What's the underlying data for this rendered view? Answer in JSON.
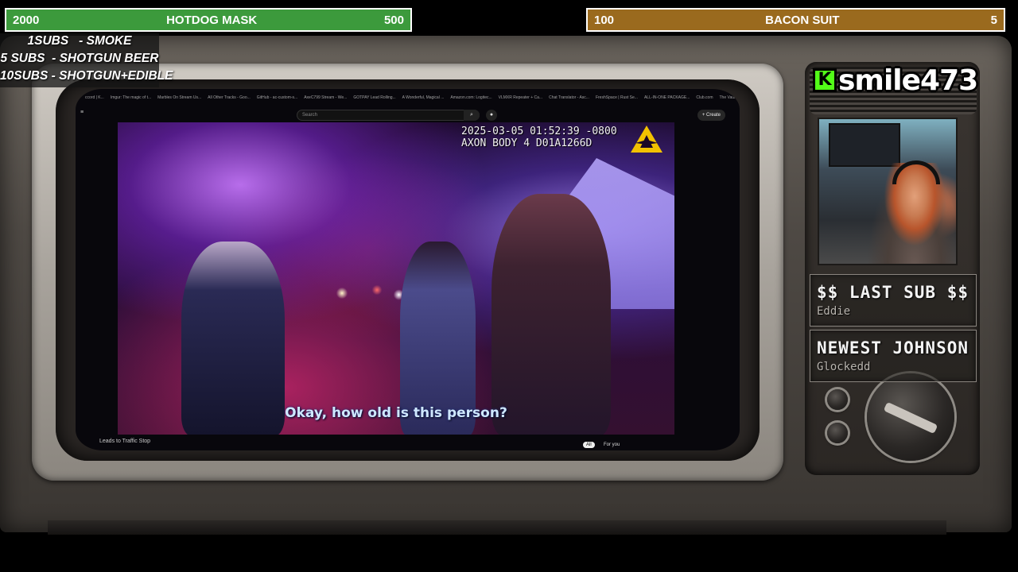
{
  "goals": {
    "left": {
      "start": "2000",
      "title": "HOTDOG MASK",
      "end": "500",
      "color": "#3c9a3c"
    },
    "right": {
      "start": "100",
      "title": "BACON SUIT",
      "end": "5",
      "color": "#9a6a1e"
    }
  },
  "sub_menu": {
    "lines": [
      "1SUBS   - SMOKE",
      "5 SUBS  - SHOTGUN BEER",
      "10SUBS - SHOTGUN+EDIBLE"
    ]
  },
  "browser": {
    "bookmarks": [
      "ccord | K...",
      "Imgur: The magic of t...",
      "Marbles On Stream Us...",
      "All Other Tracks - Goo...",
      "GitHub - ac-custom-s...",
      "AxeC799 Stream - We...",
      "GOTPAY Lead Rolling...",
      "A Wonderful, Magical ...",
      "Amazon.com: Logitec...",
      "VLMXR Repeater + Ca...",
      "Chat Translator - Asc...",
      "FreshSpace | Rust Se...",
      "ALL-IN-ONE PACKAGE...",
      "Club.com",
      "The Vault Aggressive ..."
    ],
    "search_placeholder": "Search",
    "menu_icon": "≡",
    "search_icon": "⌕",
    "mic_icon": "🎤",
    "create_label": "+ Create",
    "video_title": "Leads to Traffic Stop",
    "chip_all": "All",
    "chip_for_you": "For you"
  },
  "video": {
    "timestamp_line1": "2025-03-05 01:52:39 -0800",
    "timestamp_line2": "AXON BODY 4 D01A1266D",
    "subtitle": "Okay, how old is this person?"
  },
  "streamer": {
    "platform_icon": "K",
    "platform_color": "#53fc18",
    "name": "smile473"
  },
  "last_sub": {
    "title": "$$ LAST SUB $$",
    "value": "Eddie"
  },
  "newest": {
    "title": "NEWEST JOHNSON",
    "value": "Glockedd"
  }
}
